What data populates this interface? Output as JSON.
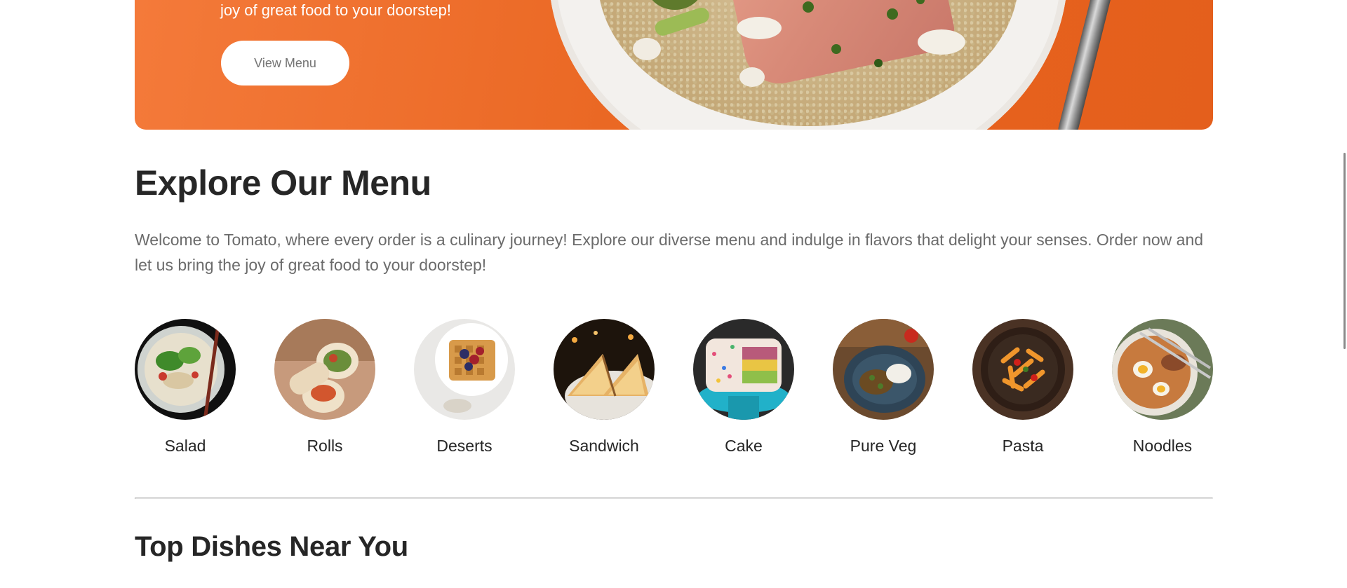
{
  "hero": {
    "tagline": "joy of great food to your doorstep!",
    "button_label": "View Menu"
  },
  "explore": {
    "title": "Explore Our Menu",
    "description": "Welcome to Tomato, where every order is a culinary journey! Explore our diverse menu and indulge in flavors that delight your senses. Order now and let us bring the joy of great food to your doorstep!"
  },
  "menu": {
    "items": [
      {
        "label": "Salad",
        "icon": "salad-image"
      },
      {
        "label": "Rolls",
        "icon": "rolls-image"
      },
      {
        "label": "Deserts",
        "icon": "deserts-image"
      },
      {
        "label": "Sandwich",
        "icon": "sandwich-image"
      },
      {
        "label": "Cake",
        "icon": "cake-image"
      },
      {
        "label": "Pure Veg",
        "icon": "pure-veg-image"
      },
      {
        "label": "Pasta",
        "icon": "pasta-image"
      },
      {
        "label": "Noodles",
        "icon": "noodles-image"
      }
    ]
  },
  "top_dishes": {
    "title": "Top Dishes Near You"
  },
  "colors": {
    "hero_orange": "#e8641f",
    "text_dark": "#262626",
    "text_muted": "#6b6b6b"
  }
}
